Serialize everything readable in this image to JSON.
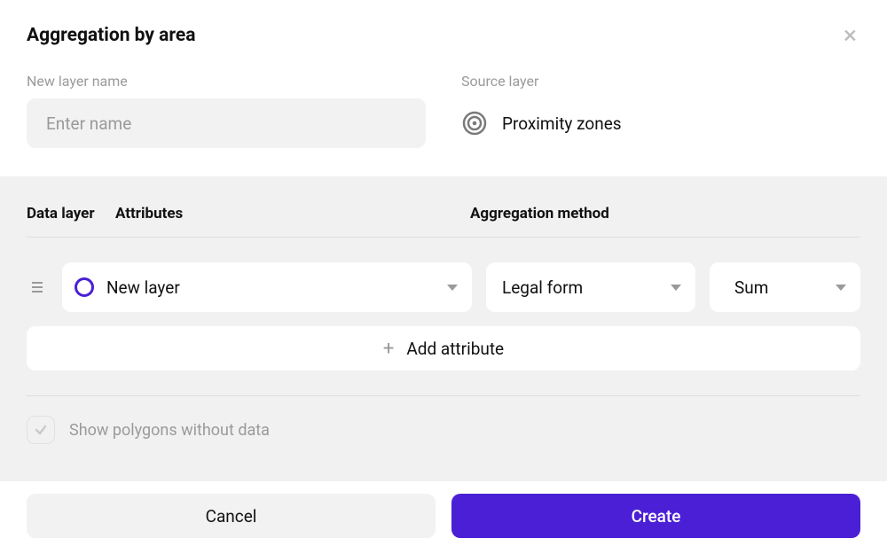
{
  "modal": {
    "title": "Aggregation by area",
    "name_label": "New layer name",
    "name_placeholder": "Enter name",
    "source_label": "Source layer",
    "source_value": "Proximity zones"
  },
  "columns": {
    "layer": "Data layer",
    "attributes": "Attributes",
    "method": "Aggregation method"
  },
  "row": {
    "layer": "New layer",
    "attribute": "Legal form",
    "method": "Sum"
  },
  "add_attribute": "Add attribute",
  "show_empty_label": "Show polygons without data",
  "footer": {
    "cancel": "Cancel",
    "create": "Create"
  },
  "colors": {
    "accent": "#4b1fd6"
  }
}
